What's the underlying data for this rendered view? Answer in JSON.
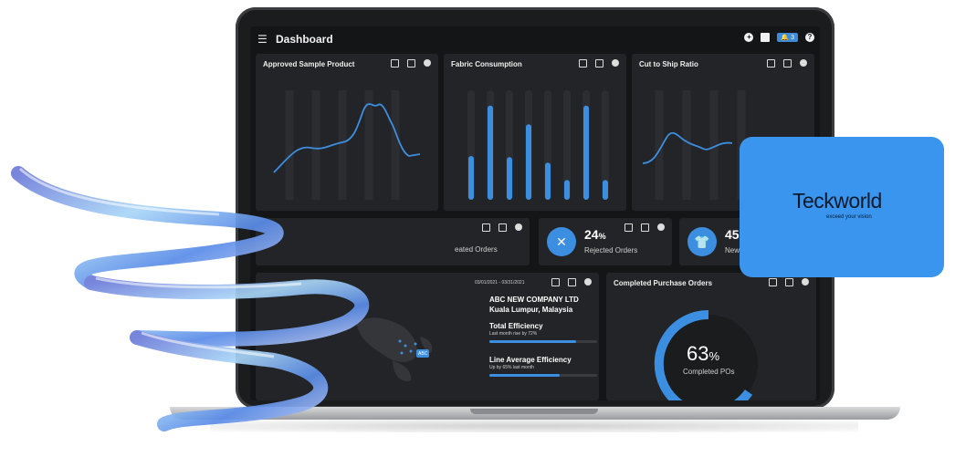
{
  "header": {
    "title": "Dashboard",
    "notifications": "3"
  },
  "cards": {
    "approved": {
      "title": "Approved Sample Product"
    },
    "fabric": {
      "title": "Fabric Consumption"
    },
    "cut": {
      "title": "Cut to Ship Ratio"
    },
    "created": {
      "label": "eated Orders"
    },
    "rejected": {
      "value": "24",
      "unit": "%",
      "label": "Rejected Orders"
    },
    "new": {
      "value": "45",
      "label": "New"
    },
    "company": {
      "date_range": "03/01/2021 - 03/31/2021",
      "name": "ABC NEW COMPANY LTD",
      "location": "Kuala Lumpur, Malaysia",
      "total_eff_title": "Total Efficiency",
      "total_eff_sub": "Last month rise by 72%",
      "line_eff_title": "Line Average Efficiency",
      "line_eff_sub": "Up by 65% last month",
      "map_pin": "ABC"
    },
    "completed": {
      "title": "Completed Purchase Orders",
      "value": "63",
      "unit": "%",
      "label": "Completed POs"
    }
  },
  "fabric_bars": [
    0.4,
    0.86,
    0.39,
    0.69,
    0.34,
    0.18,
    0.86,
    0.18
  ],
  "brand": {
    "name": "Teckworld",
    "tagline": "exceed your vision"
  },
  "colors": {
    "accent": "#3c8fe0",
    "card": "#232427",
    "brand_bg": "#3a95ef"
  }
}
